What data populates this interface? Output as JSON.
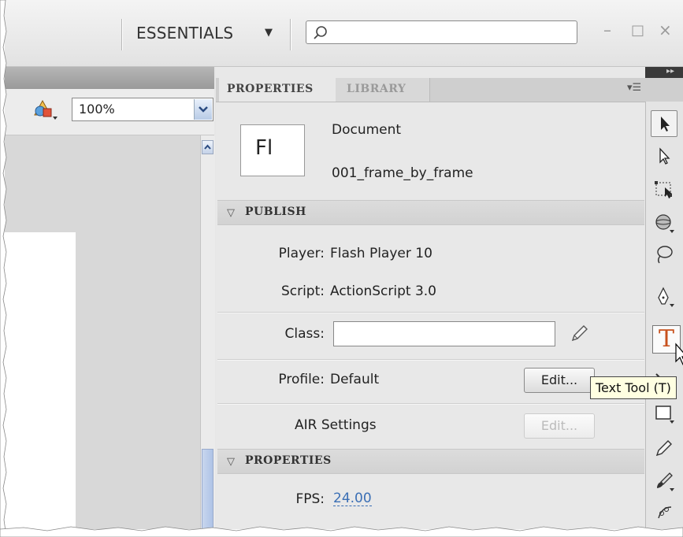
{
  "workspace": {
    "label": "ESSENTIALS",
    "dropdown_icon": "triangle-down-icon"
  },
  "search": {
    "placeholder": "",
    "icon": "search-icon"
  },
  "window_controls": {
    "minimize": "–",
    "maximize": "□",
    "close": "×"
  },
  "stage": {
    "zoom": "100%"
  },
  "panel": {
    "tabs": [
      {
        "label": "PROPERTIES",
        "active": true
      },
      {
        "label": "LIBRARY",
        "active": false
      }
    ],
    "document": {
      "icon_text": "Fl",
      "type": "Document",
      "name": "001_frame_by_frame"
    },
    "publish": {
      "title": "PUBLISH",
      "player_label": "Player:",
      "player_value": "Flash Player 10",
      "script_label": "Script:",
      "script_value": "ActionScript 3.0",
      "class_label": "Class:",
      "class_value": "",
      "profile_label": "Profile:",
      "profile_value": "Default",
      "profile_edit": "Edit...",
      "air_label": "AIR Settings",
      "air_edit": "Edit..."
    },
    "properties": {
      "title": "PROPERTIES",
      "fps_label": "FPS:",
      "fps_value": "24.00"
    }
  },
  "tools": {
    "items": [
      "selection-tool",
      "subselection-tool",
      "free-transform-tool",
      "3d-rotation-tool",
      "lasso-tool",
      "pen-tool",
      "text-tool",
      "line-tool",
      "rectangle-tool",
      "pencil-tool",
      "brush-tool",
      "deco-tool"
    ],
    "active": "text-tool",
    "text_tool_glyph": "T",
    "tooltip": "Text Tool (T)"
  },
  "colors": {
    "text_tool_accent": "#c8511d",
    "link": "#3b6fb5"
  }
}
